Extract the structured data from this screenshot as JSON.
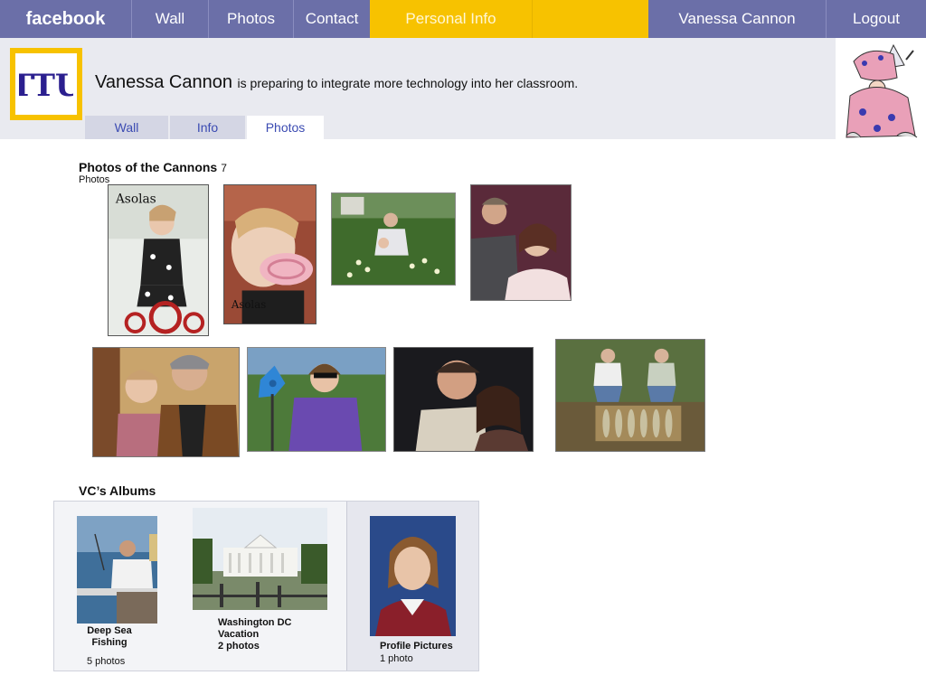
{
  "nav": {
    "brand": "facebook",
    "items": [
      "Wall",
      "Photos",
      "Contact",
      "Personal Info"
    ],
    "user": "Vanessa Cannon",
    "logout": "Logout"
  },
  "profile": {
    "name": "Vanessa Cannon",
    "status": "is preparing to integrate more technology into her classroom.",
    "logo_text": "TTU",
    "tabs": [
      "Wall",
      "Info",
      "Photos"
    ],
    "active_tab": "Photos"
  },
  "photos_section": {
    "title": "Photos of the Cannons",
    "count": "7",
    "count_label": "Photos",
    "watermark": "Asolas",
    "photos": [
      "girl-on-tricycle-photo",
      "girl-with-lollipop-photo",
      "man-with-child-in-flowers-photo",
      "couple-portrait-photo",
      "man-holding-child-photo",
      "woman-with-pinwheel-photo",
      "couple-selfie-photo",
      "two-men-with-fish-photo"
    ]
  },
  "albums": {
    "title": "VC’s Albums",
    "items": [
      {
        "title_line1": "Deep Sea",
        "title_line2": "Fishing",
        "count": "5 photos"
      },
      {
        "title_line1": "Washington DC",
        "title_line2": "Vacation",
        "count": "2 photos"
      },
      {
        "title_line1": "Profile Pictures",
        "title_line2": "",
        "count": "1 photo"
      }
    ]
  },
  "colors": {
    "nav_bg": "#6b6fa8",
    "active_tab": "#f7c200",
    "header_band": "#e9eaf0",
    "link_blue": "#3b4bb2"
  }
}
